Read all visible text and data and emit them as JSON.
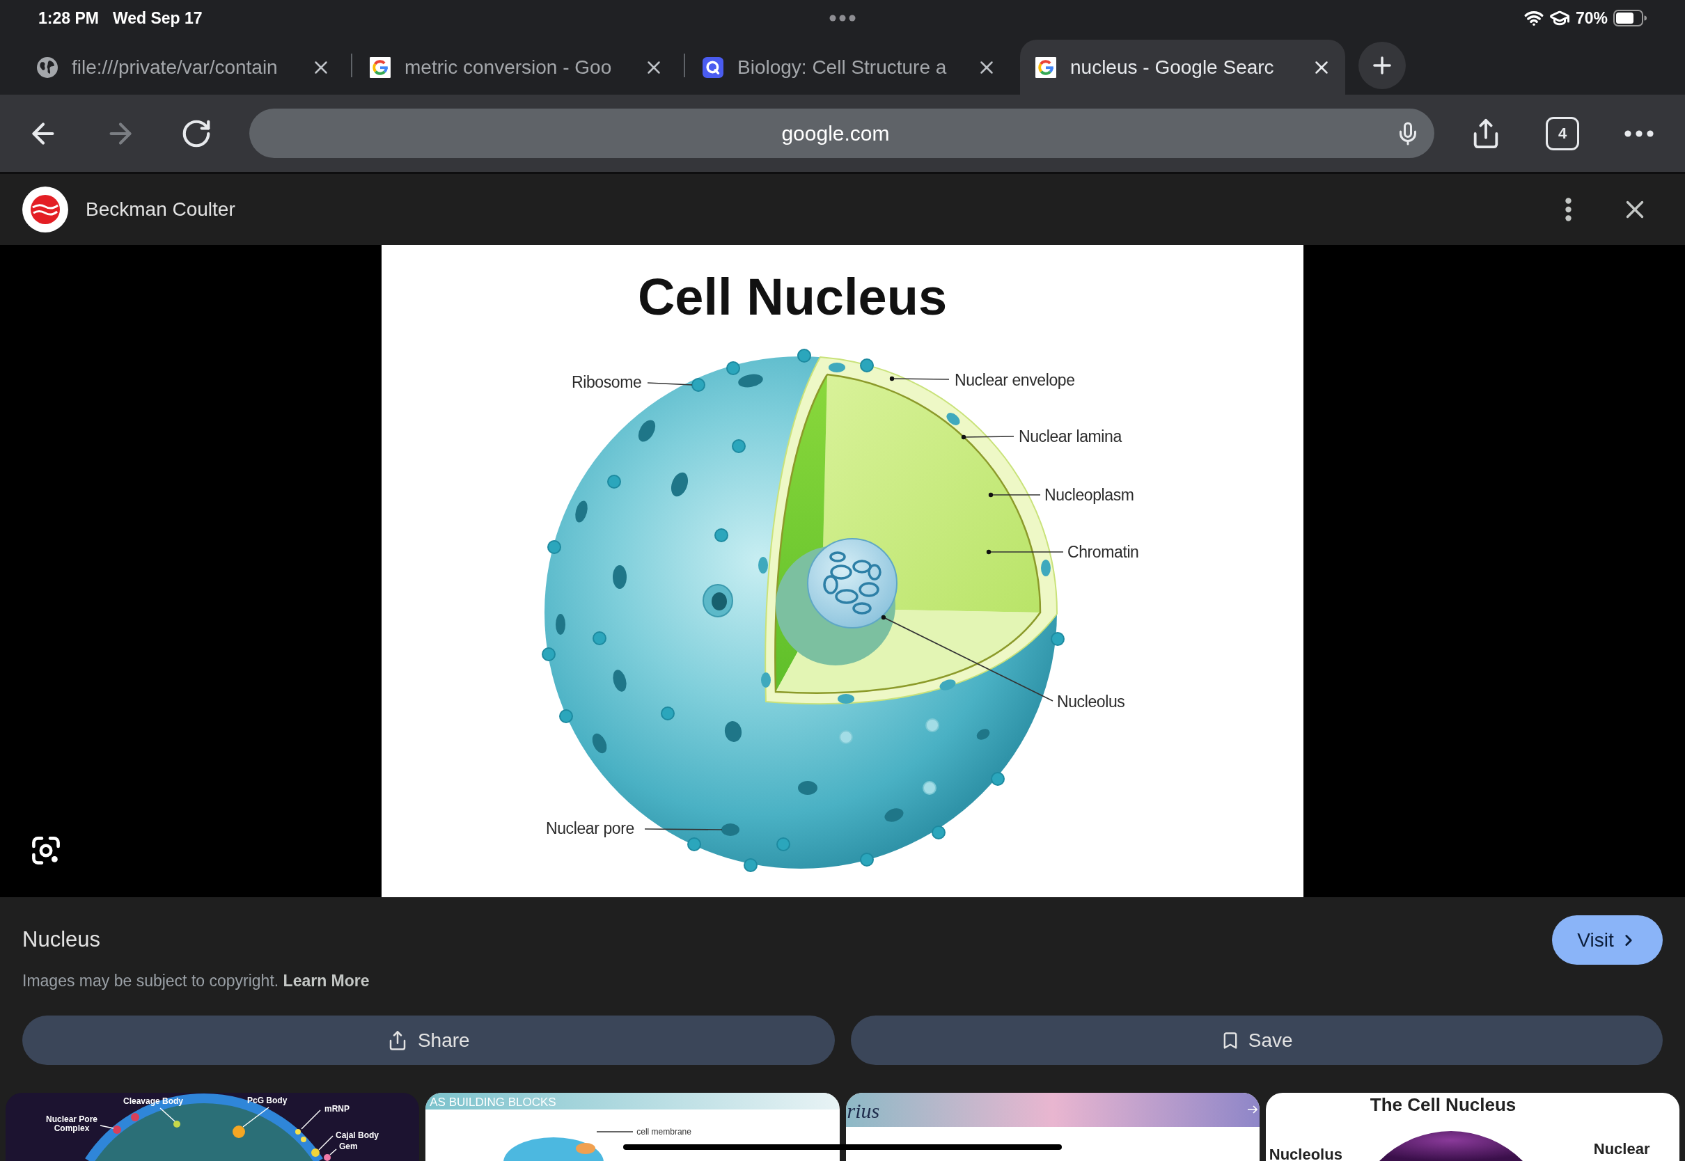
{
  "status_bar": {
    "time": "1:28 PM",
    "date": "Wed Sep 17",
    "battery": "70%"
  },
  "tabs": [
    {
      "kind": "file",
      "title": "file:///private/var/contain",
      "selected": false
    },
    {
      "kind": "google",
      "title": "metric conversion - Goo",
      "selected": false
    },
    {
      "kind": "quiz",
      "title": "Biology: Cell Structure a",
      "selected": false
    },
    {
      "kind": "google",
      "title": "nucleus - Google Searc",
      "selected": true
    }
  ],
  "toolbar": {
    "url": "google.com",
    "forward_disabled": true,
    "tab_count": "4"
  },
  "source": {
    "name": "Beckman Coulter"
  },
  "preview_image": {
    "title": "Cell Nucleus",
    "labels": [
      "Ribosome",
      "Nuclear envelope",
      "Nuclear lamina",
      "Nucleoplasm",
      "Chromatin",
      "Nucleolus",
      "Nuclear pore"
    ]
  },
  "result": {
    "title": "Nucleus",
    "notice": "Images may be subject to copyright.",
    "notice_link": "Learn More",
    "visit_button": "Visit",
    "share_button": "Share",
    "save_button": "Save"
  },
  "related_images": [
    {
      "kind": "organelle-map",
      "labels": [
        "Cleavage Body",
        "PcG Body",
        "mRNP",
        "Nuclear Pore Complex",
        "Cajal Body",
        "Gem"
      ]
    },
    {
      "kind": "banner-diagram",
      "heading": "AS BUILDING BLOCKS",
      "labels": [
        "cell membrane"
      ]
    },
    {
      "kind": "gradient-banner",
      "heading": "rius"
    },
    {
      "kind": "titled-diagram",
      "heading": "The Cell Nucleus",
      "labels": [
        "Nucleolus",
        "Nuclear"
      ]
    }
  ]
}
